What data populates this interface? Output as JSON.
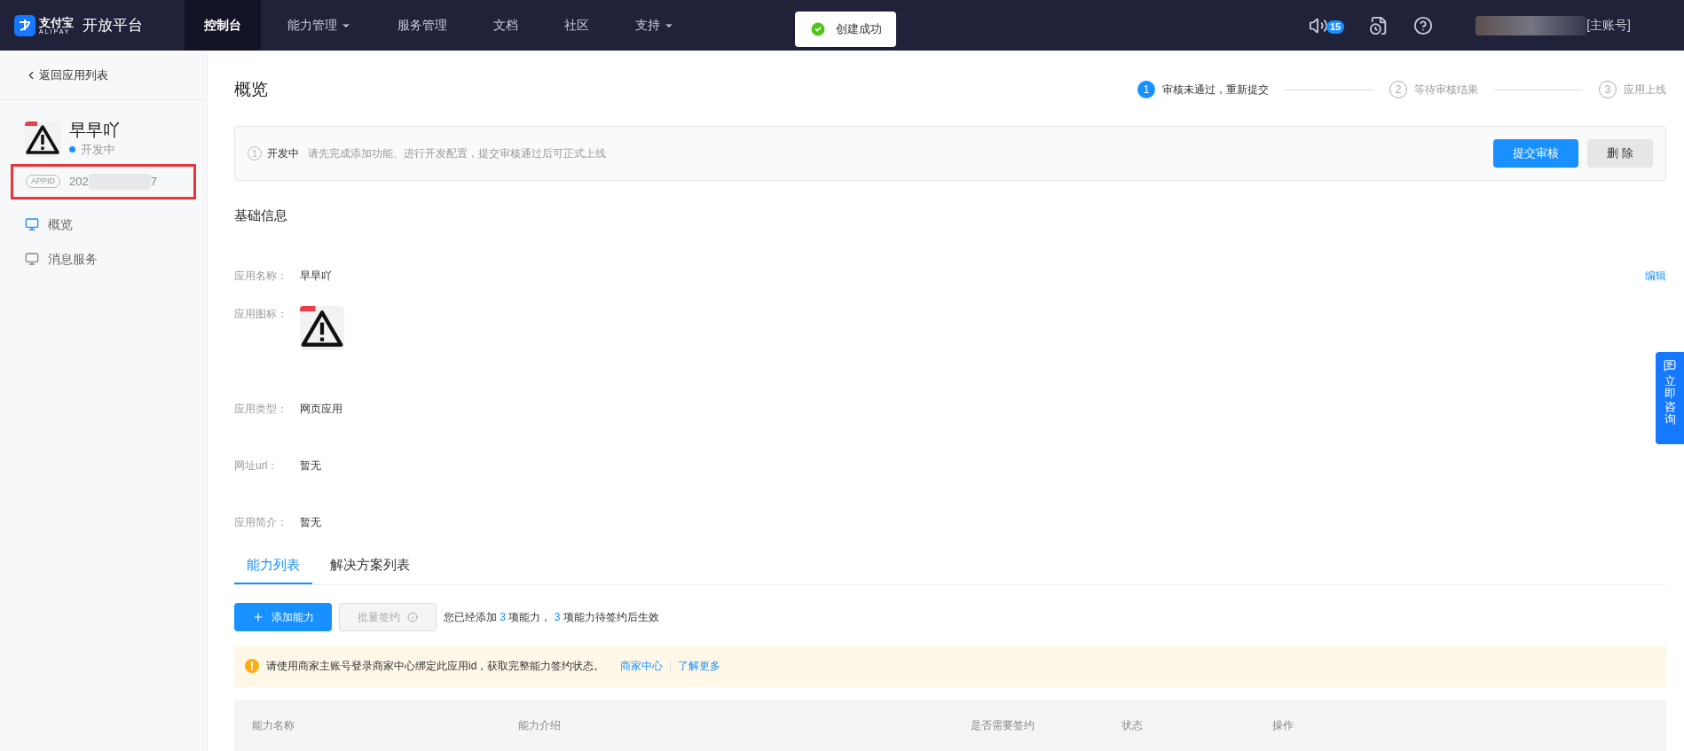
{
  "nav": {
    "brand": "支付宝",
    "brand_sub": "ALIPAY",
    "product": "开放平台",
    "menu": [
      {
        "label": "控制台",
        "selected": true,
        "dropdown": false
      },
      {
        "label": "能力管理",
        "selected": false,
        "dropdown": true
      },
      {
        "label": "服务管理",
        "selected": false,
        "dropdown": false
      },
      {
        "label": "文档",
        "selected": false,
        "dropdown": false
      },
      {
        "label": "社区",
        "selected": false,
        "dropdown": false
      },
      {
        "label": "支持",
        "selected": false,
        "dropdown": true
      }
    ],
    "toast": "创建成功",
    "notification_count": "15",
    "account_role": "[主账号]"
  },
  "sidebar": {
    "back": "返回应用列表",
    "app": {
      "name": "早早吖",
      "status": "开发中",
      "appid_label": "APPID",
      "appid_start": "202",
      "appid_end": "7"
    },
    "items": [
      {
        "label": "概览",
        "selected": true
      },
      {
        "label": "消息服务",
        "selected": false
      }
    ]
  },
  "page": {
    "title": "概览",
    "steps": [
      {
        "number": "1",
        "label": "审核未通过，重新提交",
        "selected": true
      },
      {
        "number": "2",
        "label": "等待审核结果",
        "selected": false
      },
      {
        "number": "3",
        "label": "应用上线",
        "selected": false
      }
    ],
    "notice": {
      "number": "1",
      "status": "开发中",
      "message": "请先完成添加功能、进行开发配置，提交审核通过后可正式上线",
      "buttons": [
        {
          "label": "提交审核",
          "kind": "primary"
        },
        {
          "label": "删 除",
          "kind": "default"
        }
      ]
    },
    "basic_info": {
      "title": "基础信息",
      "edit_link": "编辑",
      "fields": [
        {
          "label": "应用名称：",
          "kind": "text",
          "value": "早早吖"
        },
        {
          "label": "应用图标：",
          "kind": "icon"
        },
        {
          "label": "应用类型：",
          "kind": "text",
          "value": "网页应用"
        },
        {
          "label": "网址url：",
          "kind": "text",
          "value": "暂无"
        },
        {
          "label": "应用简介：",
          "kind": "text",
          "value": "暂无"
        }
      ]
    },
    "tabs": [
      {
        "label": "能力列表",
        "selected": true
      },
      {
        "label": "解决方案列表",
        "selected": false
      }
    ],
    "actions": {
      "add_button": "添加能力",
      "batch_button": {
        "label": "批量签约",
        "disabled": true
      },
      "summary": {
        "before": "您已经添加",
        "count": "3",
        "middle": "项能力，",
        "pending": "3",
        "after": "项能力待签约后生效"
      }
    },
    "alert": {
      "message": "请使用商家主账号登录商家中心绑定此应用id，获取完整能力签约状态。",
      "links": [
        "商家中心",
        "了解更多"
      ]
    },
    "table": {
      "columns": [
        "能力名称",
        "能力介绍",
        "是否需要签约",
        "状态",
        "操作"
      ]
    }
  },
  "consult": "立即咨询"
}
